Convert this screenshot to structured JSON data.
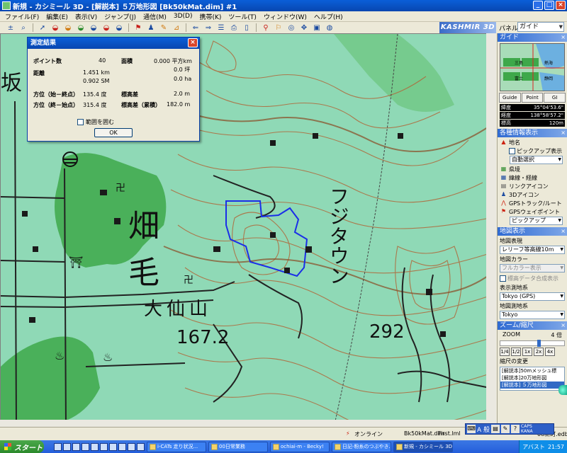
{
  "window": {
    "title": "新規 - カシミール 3D - [解説本] ５万地形図 [Bk50kMat.dim] #1",
    "min": "_",
    "max": "□",
    "close": "×"
  },
  "menu": [
    "ファイル(F)",
    "編集(E)",
    "表示(V)",
    "ジャンプ(J)",
    "通信(M)",
    "3D(D)",
    "携帯(K)",
    "ツール(T)",
    "ウィンドウ(W)",
    "ヘルプ(H)"
  ],
  "toolbar": {
    "brand": "KASHMIR 3D",
    "panel_label": "パネル",
    "panel_value": "ガイド"
  },
  "map": {
    "labels": {
      "han": "坂",
      "hata": "畑",
      "ke": "毛",
      "taisenzan": "大仙山",
      "elev1": "167.2",
      "elev2": "292",
      "fujitown": "フジタウン"
    }
  },
  "dialog": {
    "title": "測定結果",
    "close": "×",
    "points_label": "ポイント数",
    "points_value": "40",
    "area_label": "面積",
    "area_value1": "0.000 平方km",
    "area_value2": "0.0 坪",
    "area_value3": "0.0 ha",
    "dist_label": "距離",
    "dist_value1": "1.451 km",
    "dist_value2": "0.902 SM",
    "bearing1_label": "方位（始－終点）",
    "bearing1_value": "135.4 度",
    "bearing2_label": "方位（終－始点）",
    "bearing2_value": "315.4 度",
    "elevdiff_label": "標高差",
    "elevdiff_value": "2.0 m",
    "cumdiff_label": "標高差（累積）",
    "cumdiff_value": "182.0 m",
    "check_label": "範囲を囲む",
    "ok_label": "OK"
  },
  "panel": {
    "guide_title": "ガイド",
    "close": "×",
    "minimap_labels": [
      "三島",
      "熱海",
      "富士",
      "静岡"
    ],
    "tabs": [
      "Guide",
      "Point",
      "GI"
    ],
    "lat_label": "緯度",
    "lat_value": "35°04'53.6\"",
    "lon_label": "経度",
    "lon_value": "138°58'57.2\"",
    "elev_label": "標高",
    "elev_value": "120m",
    "info_title": "各種情報表示",
    "info_items": [
      "地名",
      "ピックアップ表示",
      "県境",
      "緯線・経線",
      "リンクアイコン",
      "3Dアイコン",
      "GPSトラック/ルート",
      "GPSウェイポイント"
    ],
    "info_select1": "自動選択",
    "info_select2": "ピックアップ",
    "mapdisp_title": "地図表示",
    "map_expr_label": "地図表現",
    "map_expr_value": "レリーフ等高線10m",
    "map_color_label": "地図カラー",
    "map_color_value": "フルカラー表示",
    "elev_combine_label": "標高データ合成表示",
    "datum_label": "表示測地系",
    "datum_value": "Tokyo (GPS)",
    "mapdatum_label": "地図測地系",
    "mapdatum_value": "Tokyo",
    "zoom_title": "ズーム/縮尺",
    "zoom_label": "ZOOM",
    "zoom_value": "4 倍",
    "zoom_buttons": [
      "1/4",
      "1/2",
      "1x",
      "2x",
      "4x"
    ],
    "scale_change_label": "縮尺の変更",
    "scale_items": [
      "[解説本]50mメッシュ標",
      "[解説本]20万地形図",
      "[解説本] ５万地形図"
    ]
  },
  "status": {
    "online": "オンライン",
    "file1": "Bk50kMat.dim",
    "file2": "First.lml",
    "file3": "08新町.edb"
  },
  "ime": {
    "mode": "A 般",
    "caps": "CAPS",
    "kana": "KANA"
  },
  "taskbar": {
    "start": "スタート",
    "tasks": [
      "i-CATs 走り状況...",
      "00日常業務",
      "ochiai-m - Becky!",
      "日記-粉糸のつぶやき...",
      "新規 - カシミール 3D..."
    ],
    "tray_time": "21:57",
    "tray_label": "アバスト"
  }
}
